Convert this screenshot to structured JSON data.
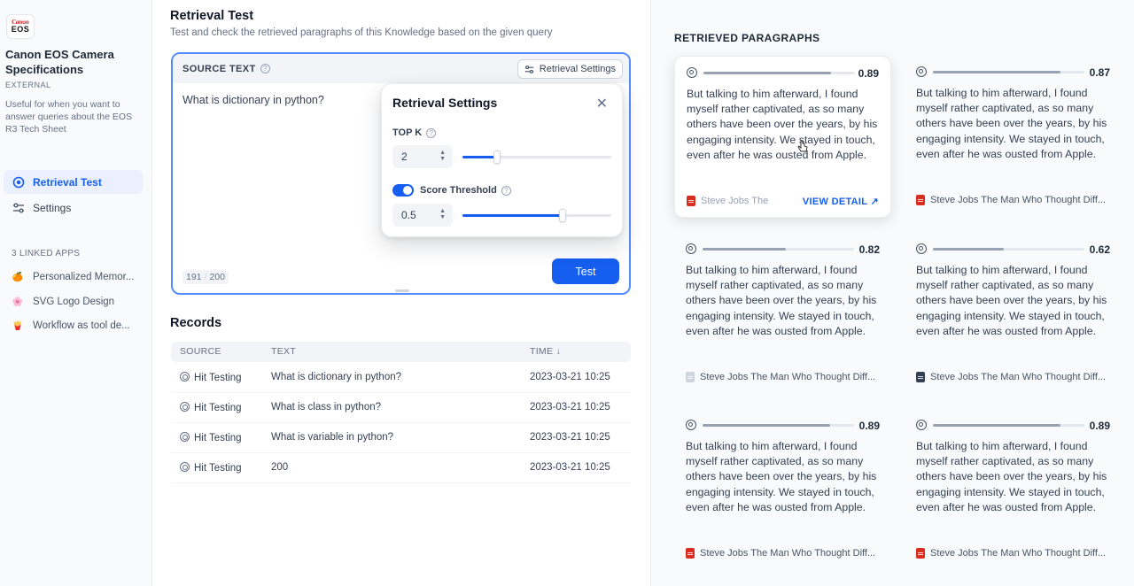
{
  "sidebar": {
    "logo": {
      "line1": "Canon",
      "line2": "EOS"
    },
    "kb_title": "Canon EOS Camera Specifications",
    "kb_type": "EXTERNAL",
    "kb_desc": "Useful for when you want to answer queries about the EOS R3 Tech Sheet",
    "nav": [
      {
        "label": "Retrieval Test",
        "icon": "target-icon",
        "active": true
      },
      {
        "label": "Settings",
        "icon": "sliders-icon",
        "active": false
      }
    ],
    "linked_title": "3 LINKED APPS",
    "apps": [
      {
        "label": "Personalized Memor...",
        "emoji": "🍊"
      },
      {
        "label": "SVG Logo Design",
        "emoji": "🌸"
      },
      {
        "label": "Workflow as tool de...",
        "emoji": "🍟"
      }
    ]
  },
  "main": {
    "title": "Retrieval Test",
    "subtitle": "Test and check the retrieved paragraphs of this Knowledge based on the given query",
    "source_label": "SOURCE TEXT",
    "retrieval_settings_btn": "Retrieval Settings",
    "query": "What is dictionary in python?",
    "count": "191",
    "limit": "200",
    "test_btn": "Test"
  },
  "popover": {
    "title": "Retrieval Settings",
    "topk_label": "TOP K",
    "topk_value": "2",
    "topk_fraction": 0.23,
    "threshold_label": "Score Threshold",
    "threshold_enabled": true,
    "threshold_value": "0.5",
    "threshold_fraction": 0.67
  },
  "records": {
    "title": "Records",
    "headers": {
      "source": "SOURCE",
      "text": "TEXT",
      "time": "TIME ↓"
    },
    "rows": [
      {
        "source": "Hit Testing",
        "text": "What is dictionary in python?",
        "time": "2023-03-21 10:25"
      },
      {
        "source": "Hit Testing",
        "text": "What is class in python?",
        "time": "2023-03-21 10:25"
      },
      {
        "source": "Hit Testing",
        "text": "What is variable in python?",
        "time": "2023-03-21 10:25"
      },
      {
        "source": "Hit Testing",
        "text": "200",
        "time": "2023-03-21 10:25"
      }
    ]
  },
  "results": {
    "title": "RETRIEVED PARAGRAPHS",
    "view_detail": "VIEW DETAIL",
    "cards": [
      {
        "score": "0.89",
        "fill": 0.84,
        "text": "But talking to him afterward, I found myself rather captivated, as so many others have been over the years, by his engaging intensity. We stayed in touch, even after he was ousted from Apple.",
        "doc": "Steve Jobs The",
        "doc_type": "pdf"
      },
      {
        "score": "0.87",
        "fill": 0.84,
        "text": "But talking to him afterward, I found myself rather captivated, as so many others have been over the years, by his engaging intensity. We stayed in touch, even after he was ousted from Apple.",
        "doc": "Steve Jobs The Man Who Thought Diff...",
        "doc_type": "pdf"
      },
      {
        "score": "0.82",
        "fill": 0.55,
        "text": "But talking to him afterward, I found myself rather captivated, as so many others have been over the years, by his engaging intensity. We stayed in touch, even after he was ousted from Apple.",
        "doc": "Steve Jobs The Man Who Thought Diff...",
        "doc_type": "txt"
      },
      {
        "score": "0.62",
        "fill": 0.47,
        "text": "But talking to him afterward, I found myself rather captivated, as so many others have been over the years, by his engaging intensity. We stayed in touch, even after he was ousted from Apple.",
        "doc": "Steve Jobs The Man Who Thought Diff...",
        "doc_type": "dark"
      },
      {
        "score": "0.89",
        "fill": 0.84,
        "text": "But talking to him afterward, I found myself rather captivated, as so many others have been over the years, by his engaging intensity. We stayed in touch, even after he was ousted from Apple.",
        "doc": "Steve Jobs The Man Who Thought Diff...",
        "doc_type": "pdf"
      },
      {
        "score": "0.89",
        "fill": 0.84,
        "text": "But talking to him afterward, I found myself rather captivated, as so many others have been over the years, by his engaging intensity. We stayed in touch, even after he was ousted from Apple.",
        "doc": "Steve Jobs The Man Who Thought Diff...",
        "doc_type": "pdf"
      }
    ]
  },
  "colors": {
    "accent": "#155eef",
    "active_bg": "#eaf0fe",
    "pdf": "#d92d20"
  }
}
